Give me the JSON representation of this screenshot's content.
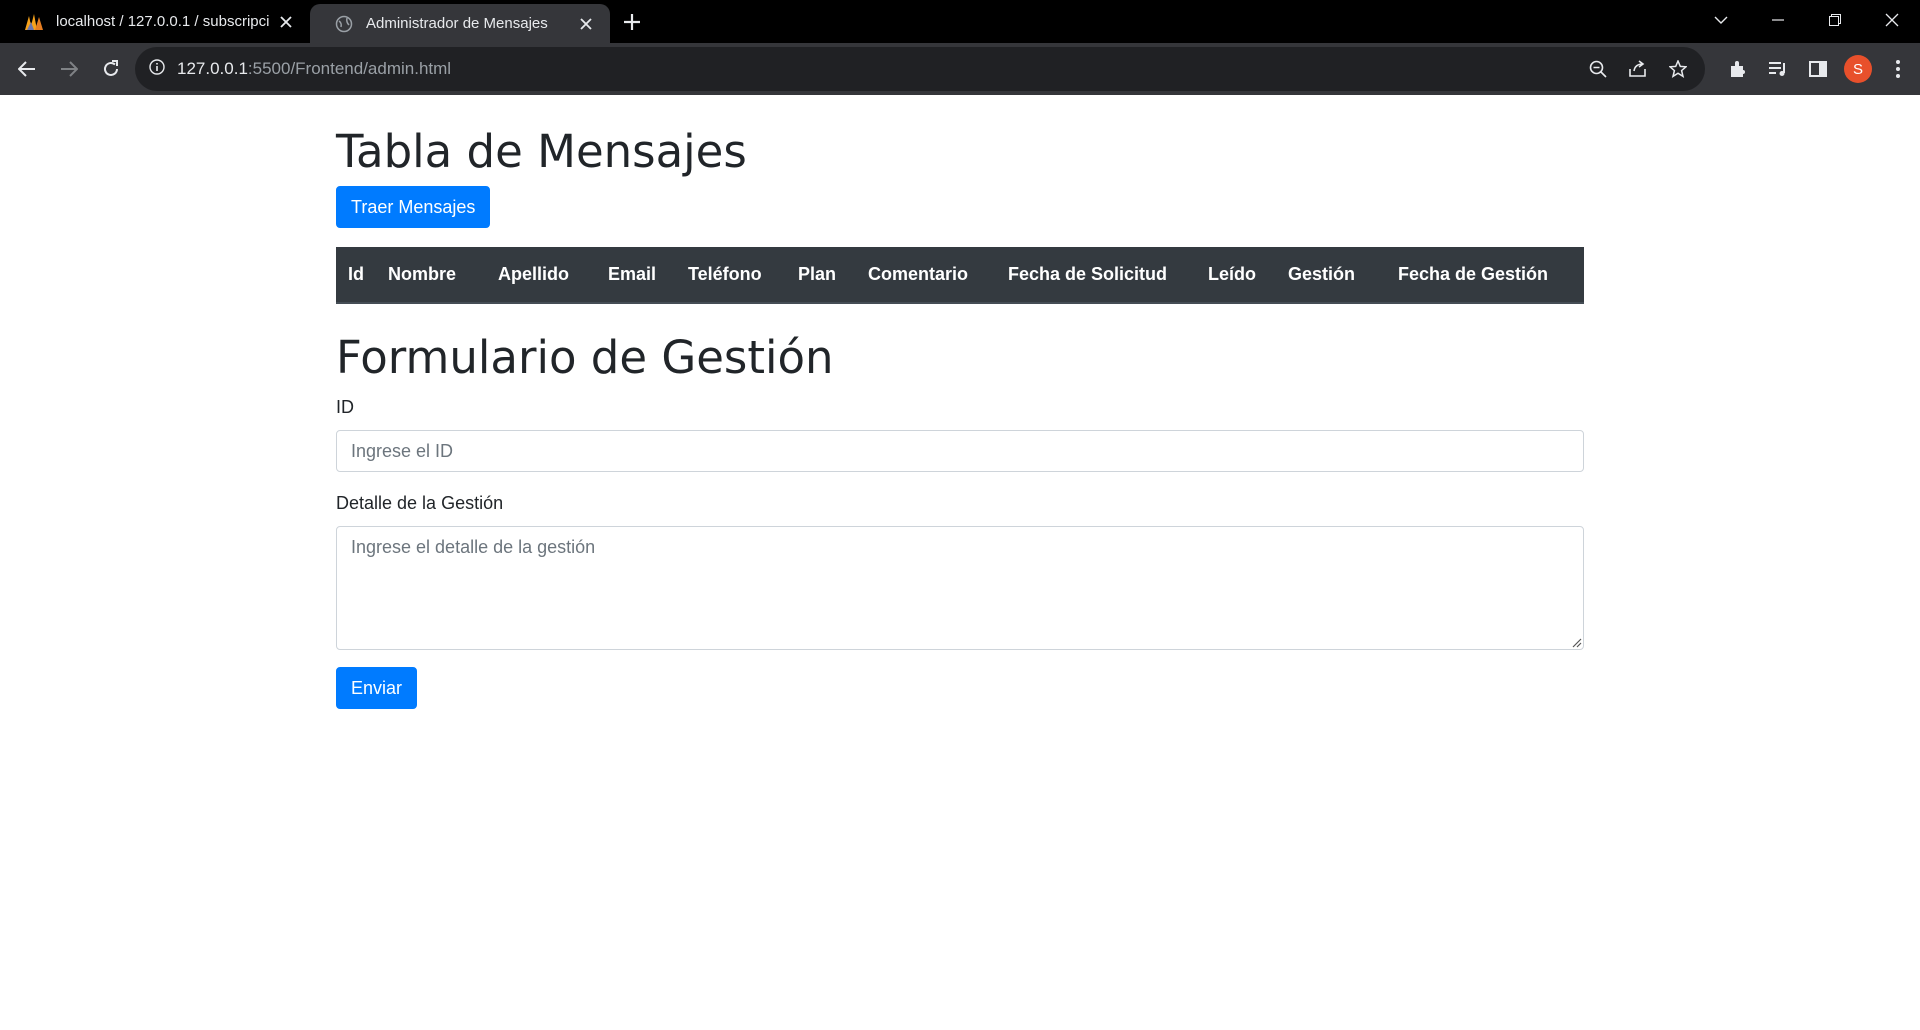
{
  "browser": {
    "tabs": [
      {
        "title": "localhost / 127.0.0.1 / subscripci",
        "active": false
      },
      {
        "title": "Administrador de Mensajes",
        "active": true
      }
    ],
    "url_host": "127.0.0.1",
    "url_path": ":5500/Frontend/admin.html",
    "profile_initial": "S"
  },
  "page": {
    "table_title": "Tabla de Mensajes",
    "fetch_button": "Traer Mensajes",
    "table_headers": [
      "Id",
      "Nombre",
      "Apellido",
      "Email",
      "Teléfono",
      "Plan",
      "Comentario",
      "Fecha de Solicitud",
      "Leído",
      "Gestión",
      "Fecha de Gestión"
    ],
    "form_title": "Formulario de Gestión",
    "id_label": "ID",
    "id_placeholder": "Ingrese el ID",
    "detail_label": "Detalle de la Gestión",
    "detail_placeholder": "Ingrese el detalle de la gestión",
    "submit_button": "Enviar"
  },
  "colors": {
    "primary": "#007bff",
    "table_header_bg": "#343a40",
    "chrome_dark": "#35363a"
  }
}
